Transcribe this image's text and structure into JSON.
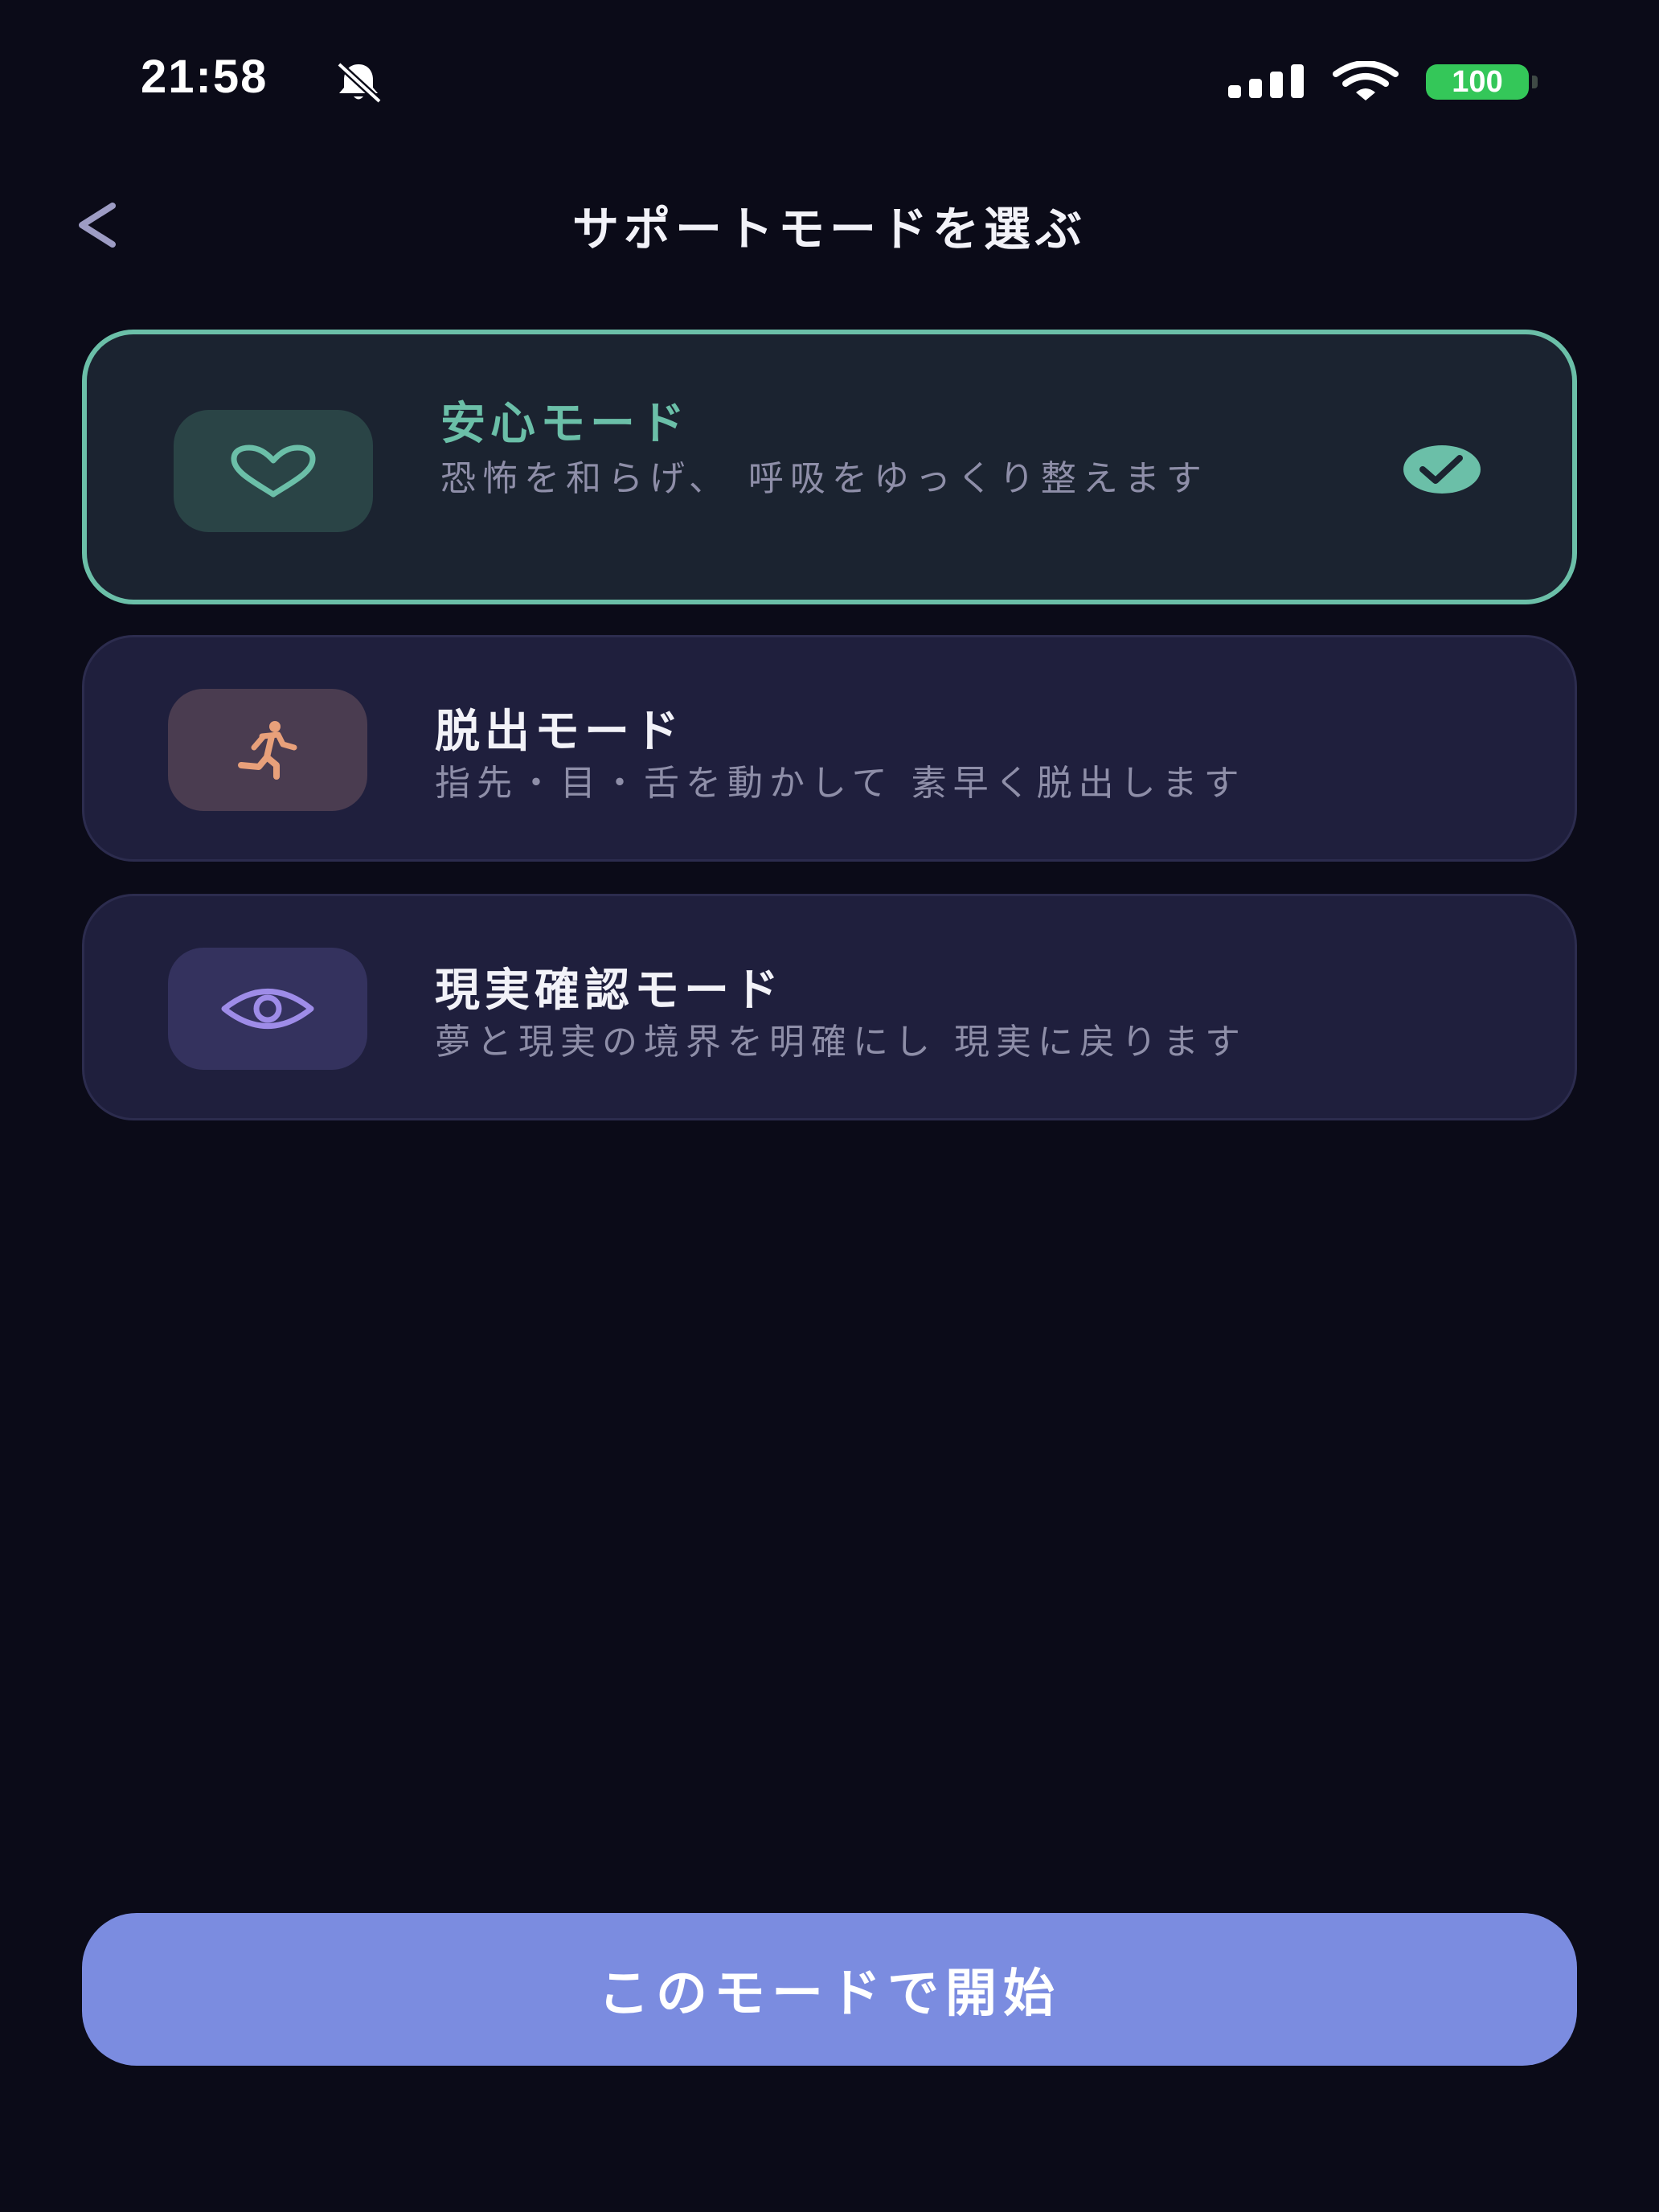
{
  "status_bar": {
    "time": "21:58",
    "battery": "100",
    "icons": [
      "bell-off-icon",
      "signal-icon",
      "wifi-icon",
      "battery-icon"
    ]
  },
  "header": {
    "title": "サポートモードを選ぶ",
    "back_icon": "chevron-left-icon"
  },
  "modes": [
    {
      "title": "安心モード",
      "description": "恐怖を和らげ、 呼吸をゆっくり整えます",
      "icon": "heart-icon",
      "selected": true,
      "accent": "#6bbfa8"
    },
    {
      "title": "脱出モード",
      "description": "指先・目・舌を動かして 素早く脱出します",
      "icon": "running-person-icon",
      "selected": false,
      "accent": "#e8a07a"
    },
    {
      "title": "現実確認モード",
      "description": "夢と現実の境界を明確にし 現実に戻ります",
      "icon": "eye-icon",
      "selected": false,
      "accent": "#9e8ce8"
    }
  ],
  "start_button": {
    "label": "このモードで開始"
  },
  "colors": {
    "background": "#0b0b18",
    "selected_border": "#6bbfa8",
    "button": "#7b8ce0",
    "battery": "#34c759"
  }
}
